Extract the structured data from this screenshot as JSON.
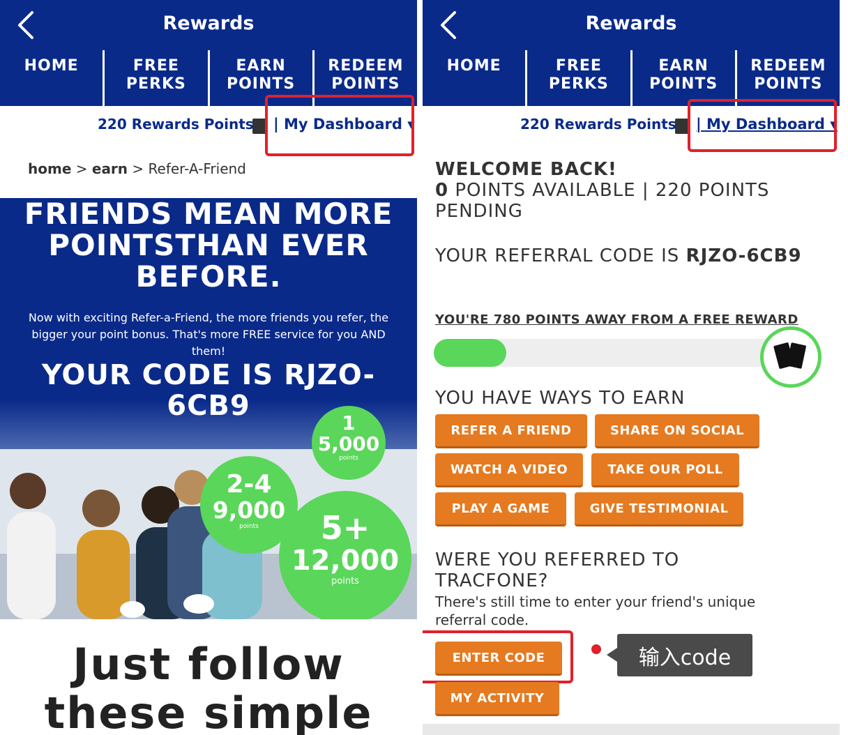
{
  "colors": {
    "brand_navy": "#0a2a8a",
    "accent_orange": "#e57a20",
    "progress_green": "#5ad65a",
    "highlight_red": "#e0202a"
  },
  "left": {
    "header": {
      "title": "Rewards",
      "back_icon": "chevron-left-icon"
    },
    "nav": [
      "HOME",
      [
        "FREE",
        "PERKS"
      ],
      [
        "EARN",
        "POINTS"
      ],
      [
        "REDEEM",
        "POINTS"
      ]
    ],
    "nav_labels": {
      "home": "HOME",
      "free1": "FREE",
      "free2": "PERKS",
      "earn1": "EARN",
      "earn2": "POINTS",
      "redeem1": "REDEEM",
      "redeem2": "POINTS"
    },
    "points_label": "220 Rewards Points",
    "dashboard_label": "| My Dashboard ▾",
    "breadcrumb": {
      "home": "home",
      "sep1": ">",
      "earn": "earn",
      "sep2": ">",
      "current": "Refer-A-Friend"
    },
    "hero": {
      "heading_line1": "FRIENDS MEAN MORE",
      "heading_line2": "POINTSTHAN EVER",
      "heading_line3": "BEFORE.",
      "paragraph": "Now with exciting Refer-a-Friend, the more friends you refer, the bigger your point bonus. That's more FREE service for you AND them!",
      "code_line1": "YOUR CODE IS RJZO-",
      "code_line2": "6CB9"
    },
    "bubbles": [
      {
        "count": "1",
        "points": "5,000",
        "unit": "points"
      },
      {
        "count": "2-4",
        "points": "9,000",
        "unit": "points"
      },
      {
        "count": "5+",
        "points": "12,000",
        "unit": "points"
      }
    ],
    "footer_line1": "Just follow",
    "footer_line2": "these simple"
  },
  "right": {
    "header": {
      "title": "Rewards",
      "back_icon": "chevron-left-icon"
    },
    "nav_labels": {
      "home": "HOME",
      "free1": "FREE",
      "free2": "PERKS",
      "earn1": "EARN",
      "earn2": "POINTS",
      "redeem1": "REDEEM",
      "redeem2": "POINTS"
    },
    "points_label": "220 Rewards Points",
    "dashboard_label": "| My Dashboard ▾",
    "welcome": "WELCOME BACK!",
    "points_available_num": "0",
    "points_status": "POINTS AVAILABLE | 220 POINTS PENDING",
    "referral_prefix": "YOUR REFERRAL CODE IS",
    "referral_code": "RJZO-6CB9",
    "away_text": "YOU'RE 780 POINTS AWAY FROM A FREE REWARD",
    "progress": 0.19,
    "ways_heading": "YOU HAVE WAYS TO EARN",
    "earn_buttons": {
      "refer": "REFER A FRIEND",
      "share": "SHARE ON SOCIAL",
      "watch": "WATCH A VIDEO",
      "poll": "TAKE OUR POLL",
      "game": "PLAY A GAME",
      "testimonial": "GIVE TESTIMONIAL"
    },
    "referred_heading": "WERE YOU REFERRED TO TRACFONE?",
    "referred_text": "There's still time to enter your friend's unique referral code.",
    "enter_code_label": "ENTER CODE",
    "my_activity_label": "MY ACTIVITY"
  },
  "annotation": {
    "tooltip_text": "输入code"
  }
}
